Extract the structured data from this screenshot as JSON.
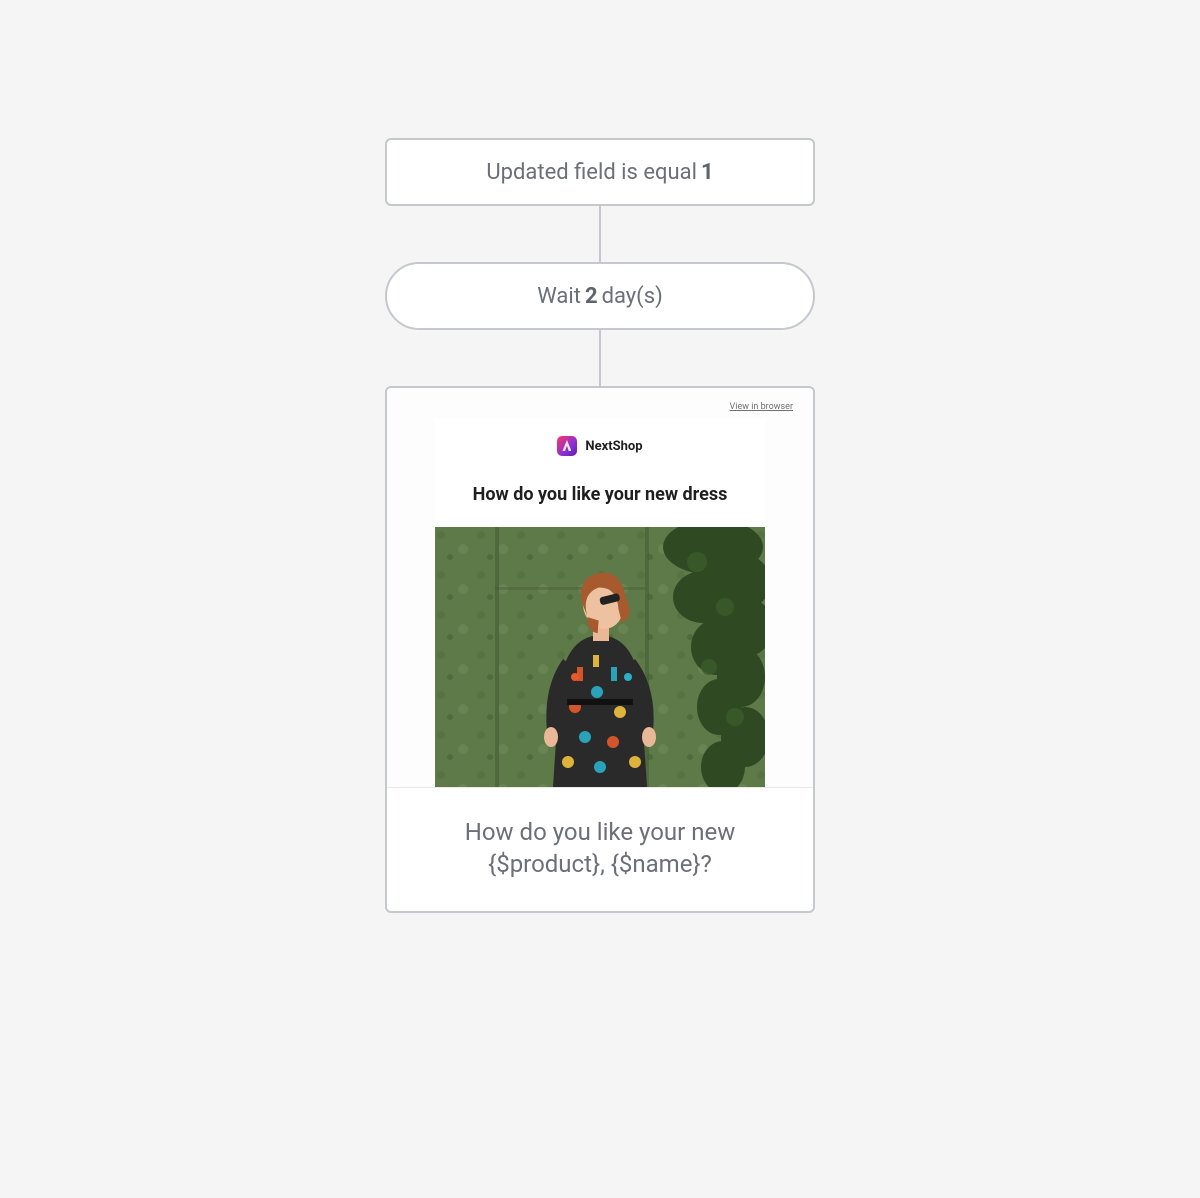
{
  "condition": {
    "text_prefix": "Updated field is equal",
    "value": "1"
  },
  "wait": {
    "text_prefix": "Wait",
    "value": "2",
    "text_suffix": "day(s)"
  },
  "email": {
    "preview": {
      "view_in_browser": "View in browser",
      "brand_name": "NextShop",
      "headline": "How do you like your new dress"
    },
    "subject": "How do you like your new {$product}, {$name}?"
  }
}
